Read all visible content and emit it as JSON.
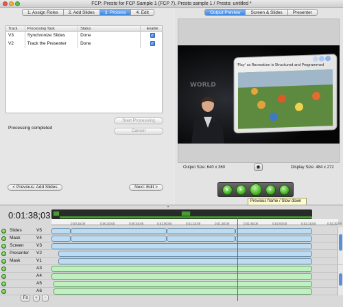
{
  "window": {
    "title": "FCP: Presto for FCP Sample 1 (FCP 7), Presto sample 1 / Presto: untitled *"
  },
  "steps": [
    "1. Assign Roles",
    "2. Add Slides",
    "3. Process",
    "4. Edit"
  ],
  "task_table": {
    "headers": [
      "Track",
      "Processing Task",
      "Status",
      "Enable"
    ],
    "rows": [
      {
        "track": "V3",
        "task": "Synchronize Slides",
        "status": "Done"
      },
      {
        "track": "V2",
        "task": "Track the Presenter",
        "status": "Done"
      }
    ]
  },
  "processing": {
    "status": "Processing completed",
    "start_label": "Start Processing",
    "cancel_label": "Cancel"
  },
  "nav": {
    "prev_label": "< Previous: Add Slides",
    "next_label": "Next: Edit >"
  },
  "preview_tabs": [
    "Output Preview",
    "Screen & Slides",
    "Presenter"
  ],
  "preview": {
    "slide_title": "'Play' as Recreation is Structured and Programmed",
    "output_size": "Output Size:  640 x 360",
    "display_size": "Display Size:  484 x 272"
  },
  "tooltip": "Previous frame / Slow down",
  "timeline": {
    "timecode": "0:01:38;03",
    "ruler_ticks": [
      "0:00:15;00",
      "0:00:30;00",
      "0:00:45;00",
      "0:01:00;00",
      "0:01:15;00",
      "0:01:30;00",
      "0:01:45;00",
      "0:02:00;00",
      "0:02:15;00",
      "0:02:30;00"
    ],
    "tracks": [
      {
        "label": "Slides",
        "id": "V5"
      },
      {
        "label": "Mask",
        "id": "V4"
      },
      {
        "label": "Screen",
        "id": "V3"
      },
      {
        "label": "Presenter",
        "id": "V2"
      },
      {
        "label": "Mask",
        "id": "V1"
      },
      {
        "label": "",
        "id": "A3"
      },
      {
        "label": "",
        "id": "A4"
      },
      {
        "label": "",
        "id": "A5"
      },
      {
        "label": "",
        "id": "A6"
      }
    ],
    "fit_label": "Fit",
    "zoom_in_label": "+",
    "zoom_out_label": "−"
  }
}
